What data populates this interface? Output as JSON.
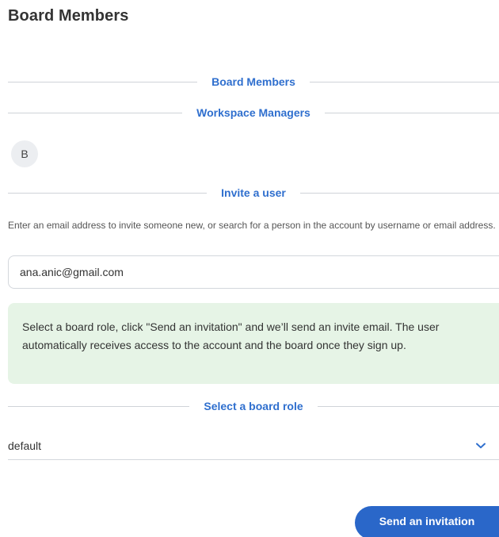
{
  "page": {
    "title": "Board Members"
  },
  "sections": {
    "board_members": "Board Members",
    "workspace_managers": "Workspace Managers",
    "invite_user": "Invite a user",
    "select_role": "Select a board role"
  },
  "managers": [
    {
      "initial": "B"
    }
  ],
  "invite": {
    "help_text": "Enter an email address to invite someone new, or search for a person in the account by username or email address.",
    "email_value": "ana.anic@gmail.com",
    "info_text": "Select a board role, click \"Send an invitation\" and we’ll send an invite email. The user automatically receives access to the account and the board once they sign up."
  },
  "role": {
    "selected": "default",
    "icon": "chevron-down-icon"
  },
  "actions": {
    "send_label": "Send an invitation"
  },
  "colors": {
    "accent": "#2f6fce",
    "button": "#2a67c9",
    "info_bg": "#e6f4e6"
  }
}
